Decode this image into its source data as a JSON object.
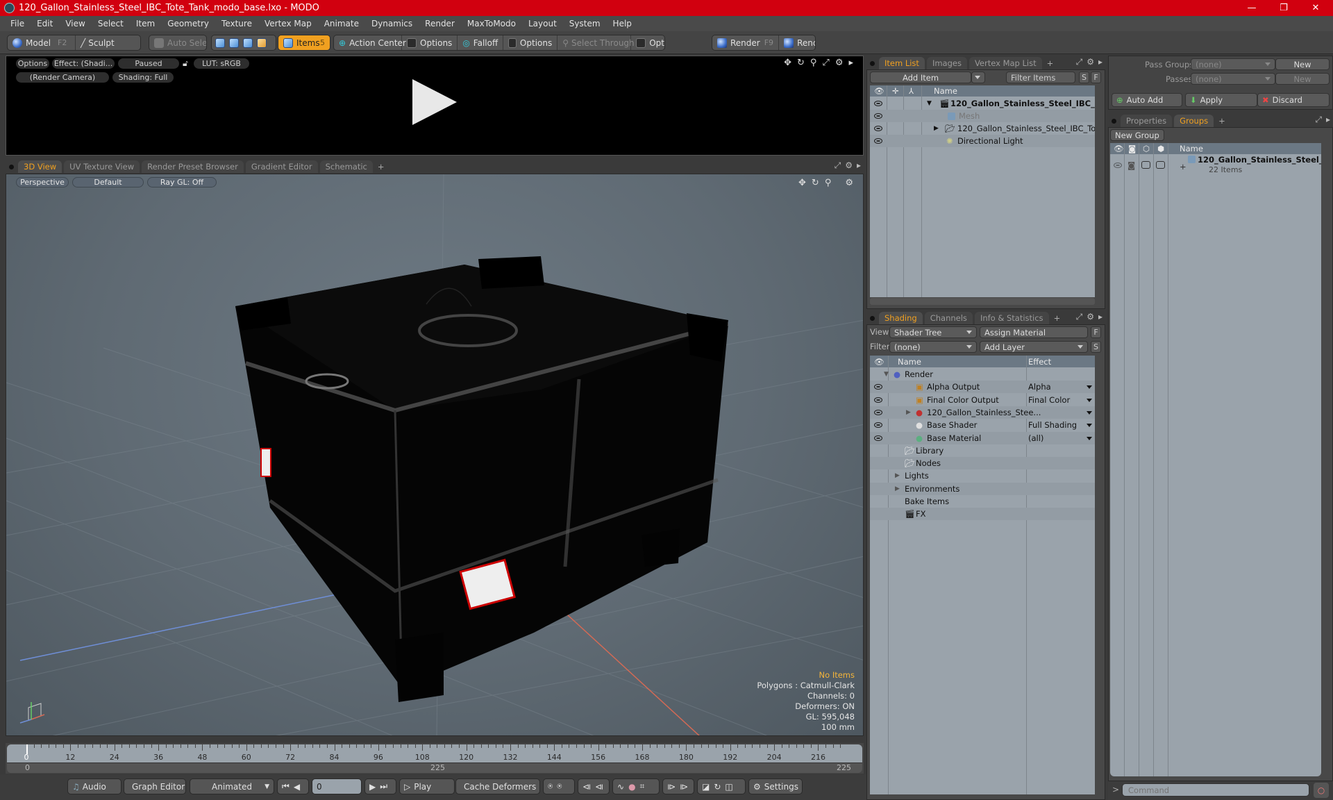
{
  "window": {
    "title": "120_Gallon_Stainless_Steel_IBC_Tote_Tank_modo_base.lxo - MODO",
    "controls": {
      "minimize": "—",
      "restore": "❐",
      "close": "✕"
    }
  },
  "menu": [
    "File",
    "Edit",
    "View",
    "Select",
    "Item",
    "Geometry",
    "Texture",
    "Vertex Map",
    "Animate",
    "Dynamics",
    "Render",
    "MaxToModo",
    "Layout",
    "System",
    "Help"
  ],
  "toolbar": {
    "model": "Model",
    "model_key": "F2",
    "sculpt": "Sculpt",
    "auto_select": "Auto Select",
    "items": "Items",
    "items_key": "5",
    "action_center": "Action Center",
    "options1": "Options",
    "falloff": "Falloff",
    "options2": "Options",
    "select_through": "Select Through",
    "options3": "Options",
    "render": "Render",
    "render_key": "F9",
    "render_window": "Render Window"
  },
  "preview": {
    "options": "Options",
    "effect": "Effect: (Shadi...",
    "paused": "Paused",
    "lut": "LUT: sRGB",
    "camera": "(Render Camera)",
    "shading": "Shading: Full"
  },
  "viewport_tabs": [
    "3D View",
    "UV Texture View",
    "Render Preset Browser",
    "Gradient Editor",
    "Schematic"
  ],
  "viewport": {
    "projection": "Perspective",
    "style": "Default",
    "raygl": "Ray GL: Off",
    "hud": {
      "selection": "No Items",
      "polygons": "Polygons : Catmull-Clark",
      "channels": "Channels: 0",
      "deformers": "Deformers: ON",
      "gl": "GL: 595,048",
      "scale": "100 mm"
    }
  },
  "item_list": {
    "tabs": [
      "Item List",
      "Images",
      "Vertex Map List"
    ],
    "add_item": "Add Item",
    "filter_placeholder": "Filter Items",
    "s": "S",
    "f": "F",
    "column_name": "Name",
    "rows": [
      {
        "label": "120_Gallon_Stainless_Steel_IBC_ ...",
        "type": "scene"
      },
      {
        "label": "Mesh",
        "type": "mesh"
      },
      {
        "label": "120_Gallon_Stainless_Steel_IBC_Tote ...",
        "type": "group"
      },
      {
        "label": "Directional Light",
        "type": "light"
      }
    ]
  },
  "shading": {
    "tabs": [
      "Shading",
      "Channels",
      "Info & Statistics"
    ],
    "view_label": "View",
    "view_value": "Shader Tree",
    "assign_material": "Assign Material",
    "f": "F",
    "filter_label": "Filter",
    "filter_value": "(none)",
    "add_layer": "Add Layer",
    "s": "S",
    "col_name": "Name",
    "col_effect": "Effect",
    "rows": [
      {
        "label": "Render",
        "effect": ""
      },
      {
        "label": "Alpha Output",
        "effect": "Alpha"
      },
      {
        "label": "Final Color Output",
        "effect": "Final Color"
      },
      {
        "label": "120_Gallon_Stainless_Stee...",
        "effect": ""
      },
      {
        "label": "Base Shader",
        "effect": "Full Shading"
      },
      {
        "label": "Base Material",
        "effect": "(all)"
      },
      {
        "label": "Library",
        "effect": ""
      },
      {
        "label": "Nodes",
        "effect": ""
      },
      {
        "label": "Lights",
        "effect": ""
      },
      {
        "label": "Environments",
        "effect": ""
      },
      {
        "label": "Bake Items",
        "effect": ""
      },
      {
        "label": "FX",
        "effect": ""
      }
    ]
  },
  "passes": {
    "pass_groups_label": "Pass Groups",
    "pass_groups_value": "(none)",
    "new1": "New",
    "passes_label": "Passes",
    "passes_value": "(none)",
    "new2": "New",
    "auto_add": "Auto Add",
    "apply": "Apply",
    "discard": "Discard"
  },
  "groups": {
    "tabs": [
      "Properties",
      "Groups"
    ],
    "new_group": "New Group",
    "col_name": "Name",
    "row_label": "120_Gallon_Stainless_Steel_...",
    "row_sub": "22 Items"
  },
  "timeline": {
    "ticks": [
      0,
      12,
      24,
      36,
      48,
      60,
      72,
      84,
      96,
      108,
      120,
      132,
      144,
      156,
      168,
      180,
      192,
      204,
      216
    ],
    "range_start": "0",
    "range_end": "225",
    "range_end2": "225",
    "max": 225,
    "current": 0
  },
  "transport": {
    "audio": "Audio",
    "graph_editor": "Graph Editor",
    "animated": "Animated",
    "frame": "0",
    "play": "Play",
    "cache_deformers": "Cache Deformers",
    "settings": "Settings"
  },
  "command": {
    "prompt": ">",
    "placeholder": "Command"
  },
  "colors": {
    "accent": "#f0a020",
    "titlebar": "#d1000f"
  }
}
